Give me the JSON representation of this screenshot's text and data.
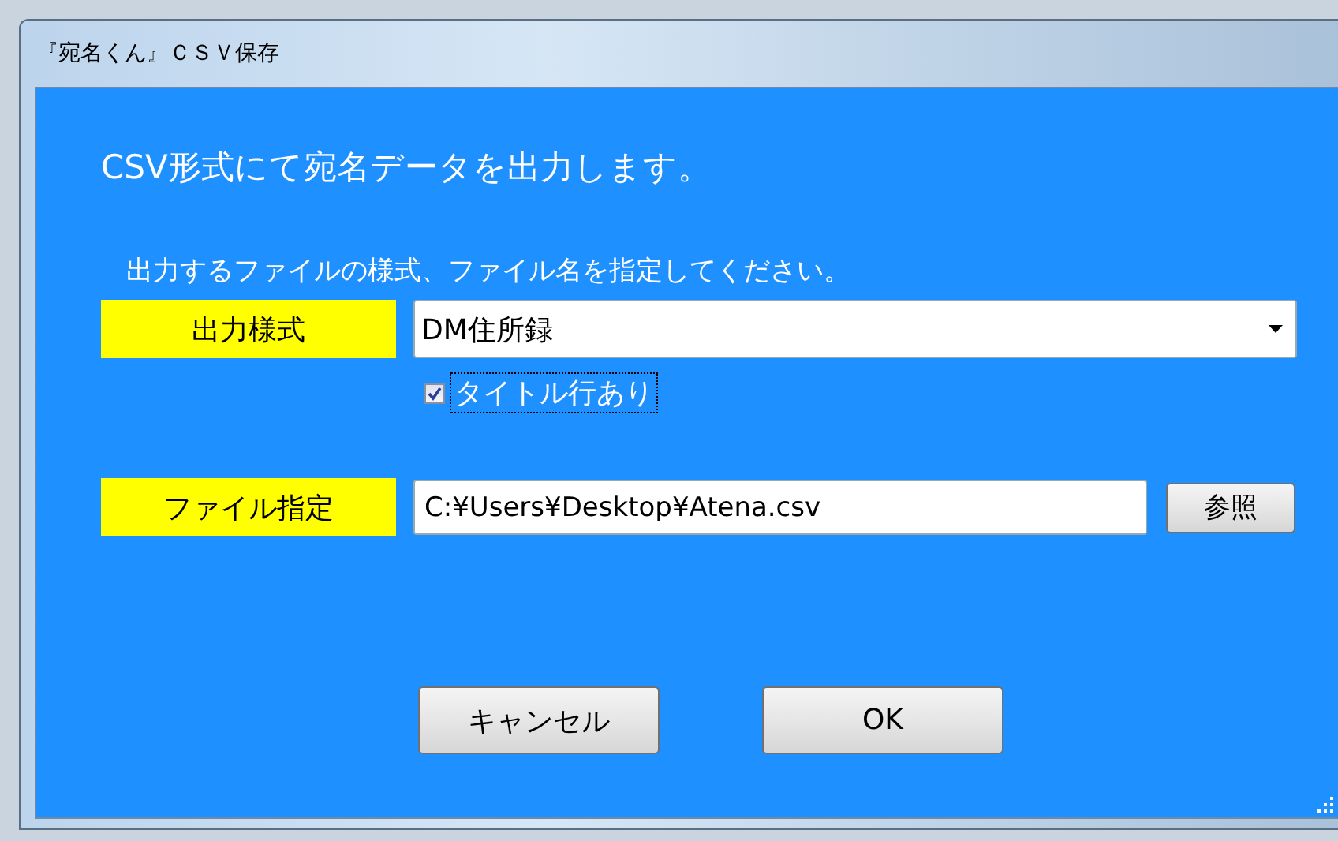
{
  "window": {
    "title": "『宛名くん』ＣＳＶ保存"
  },
  "heading": "CSV形式にて宛名データを出力します。",
  "instruction": "出力するファイルの様式、ファイル名を指定してください。",
  "format": {
    "label": "出力様式",
    "value": "DM住所録"
  },
  "title_row": {
    "label": "タイトル行あり",
    "checked": true
  },
  "file": {
    "label": "ファイル指定",
    "value": "C:¥Users¥Desktop¥Atena.csv",
    "browse": "参照"
  },
  "buttons": [
    {
      "label": "キャンセル"
    },
    {
      "label": "OK"
    }
  ]
}
